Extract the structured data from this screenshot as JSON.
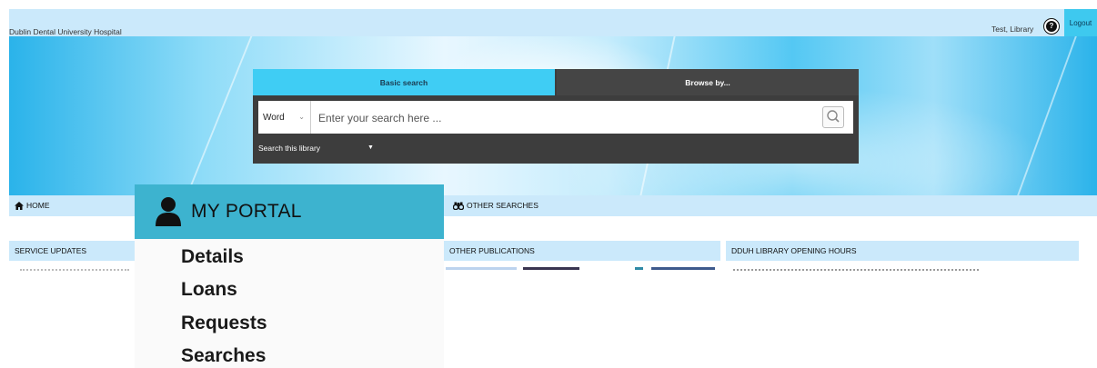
{
  "header": {
    "hospital_name": "Dublin Dental University Hospital",
    "user_name": "Test, Library",
    "help_icon": "question-circle-icon",
    "logout_label": "Logout"
  },
  "search": {
    "tabs": {
      "basic": "Basic search",
      "browse": "Browse by..."
    },
    "field_type": "Word",
    "placeholder": "Enter your search here ...",
    "scope_label": "Search this library",
    "search_icon": "magnifier-icon"
  },
  "nav": {
    "home_label": "HOME",
    "other_searches_label": "OTHER SEARCHES"
  },
  "sections": {
    "service_updates": "SERVICE UPDATES",
    "other_publications": "OTHER PUBLICATIONS",
    "opening_hours": "DDUH LIBRARY OPENING HOURS"
  },
  "portal": {
    "title": "MY PORTAL",
    "items": [
      "Details",
      "Loans",
      "Requests",
      "Searches"
    ]
  },
  "colors": {
    "accent": "#3ec9ef",
    "nav_bg": "#cbe9fb",
    "portal_header": "#3db3cf",
    "search_panel": "#3d3d3d"
  }
}
